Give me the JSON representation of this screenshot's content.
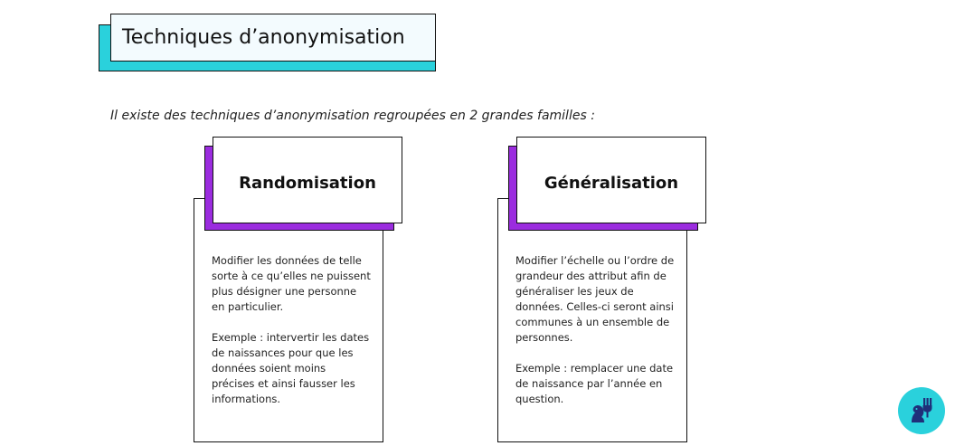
{
  "title": "Techniques d’anonymisation",
  "intro": "Il existe des techniques d’anonymisation regroupées en 2 grandes familles :",
  "cards": [
    {
      "title": "Randomisation",
      "description": "Modifier les données de telle sorte à ce qu’elles ne puissent plus désigner une personne en particulier.",
      "example": "Exemple : intervertir les dates de naissances pour que les données soient moins précises et ainsi fausser les informations."
    },
    {
      "title": "Généralisation",
      "description": "Modifier l’échelle ou l’ordre de grandeur des attribut afin de généraliser les jeux de données. Celles-ci seront ainsi communes à un ensemble de personnes.",
      "example": "Exemple : remplacer une date de naissance par l’année en question."
    }
  ],
  "colors": {
    "title_accent": "#2ad1dc",
    "card_accent": "#9b2cdf",
    "logo_bg": "#2ad1dc"
  },
  "logo": {
    "icon": "knight-fork-logo-icon"
  }
}
